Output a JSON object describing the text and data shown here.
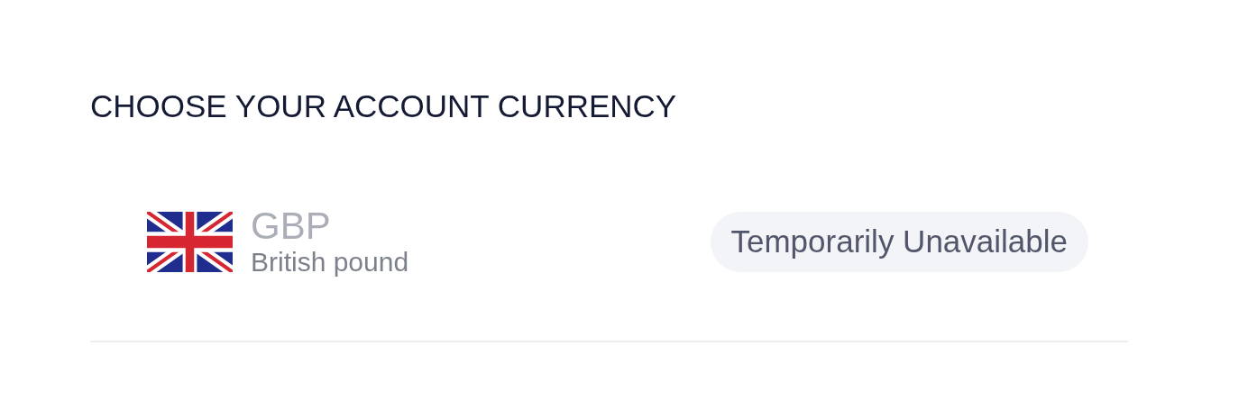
{
  "heading": "CHOOSE YOUR ACCOUNT CURRENCY",
  "currencies": [
    {
      "code": "GBP",
      "name": "British pound",
      "disabled": true,
      "status": "Temporarily Unavailable"
    }
  ]
}
